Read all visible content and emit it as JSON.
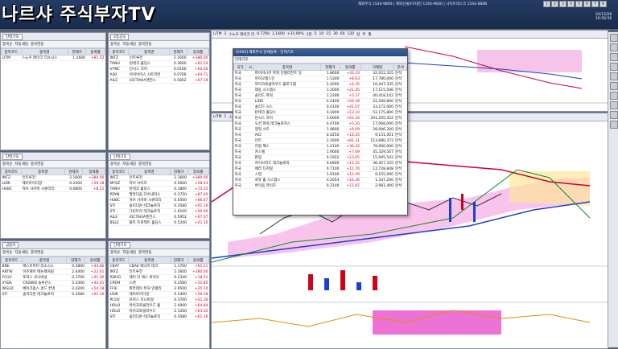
{
  "top": {
    "logo": "나르샤 주식부자TV",
    "hotlines": "해외주식 1544-9800 | 해외선물/FX대전 1544-9600 | 나이트데스크 1544-8888",
    "num_tabs": [
      "1",
      "2",
      "3",
      "4",
      "5",
      "6",
      "7",
      "8"
    ],
    "date": "24/12/28",
    "time": "16:56:56"
  },
  "panels": {
    "p1": {
      "search": "단테기호",
      "chk": [
        "종목순",
        "자동세팅",
        "종목연동"
      ],
      "headers": [
        "종목코드",
        "종목명",
        "현재가",
        "등락률"
      ],
      "rows": [
        [
          "LITM",
          "스노우 레이크 리소시스",
          "1.1600",
          "+81.52"
        ]
      ]
    },
    "p2": {
      "search": "2등공모",
      "chk": [
        "종목순",
        "자동세팅",
        "종목연동"
      ],
      "headers": [
        "종목코드",
        "종목명",
        "현재가",
        "등락률"
      ],
      "rows": [
        [
          "INTZ",
          "인트루전",
          "2.1600",
          "+380.00"
        ],
        [
          "TANH",
          "탄테크 홀딩스",
          "0.3600",
          "+81.54"
        ],
        [
          "VYNC",
          "빈시스 코어",
          "0.0160",
          "+60.00"
        ],
        [
          "AIXI",
          "아이아이스 시트라빈",
          "0.0700",
          "+64.71"
        ],
        [
          "AILE",
          "iOCTAVIA엔전스",
          "0.5852",
          "+67.19"
        ]
      ]
    },
    "p3": {
      "search": "단테기호",
      "chk": [
        "종목순",
        "자동세팅",
        "종목연동"
      ],
      "headers": [
        "종목코드",
        "종목명",
        "현재가",
        "등락률"
      ],
      "rows": [
        [
          "INTZ",
          "인트루전",
          "2.1600",
          "+380.00"
        ],
        [
          "LIDR",
          "에이아이디알",
          "0.2400",
          "+59.38"
        ],
        [
          "HUBC",
          "허브 사이버 시큐리티",
          "0.0800",
          "+8.21"
        ]
      ]
    },
    "p4": {
      "search": "단테기호",
      "chk": [
        "종목순",
        "자동세팅",
        "종목연동"
      ],
      "headers": [
        "종목코드",
        "종목명",
        "현재가",
        "등락률"
      ],
      "rows": [
        [
          "INTZ",
          "인트루전",
          "2.1600",
          "+380.00"
        ],
        [
          "MYSZ",
          "마이 사이즈",
          "0.5000",
          "+58.43"
        ],
        [
          "TANH",
          "탄테크 홀딩스",
          "0.1800",
          "+13.35"
        ],
        [
          "PDYN",
          "팔라디움 다이내믹스",
          "0.3750",
          "+87.40"
        ],
        [
          "HUBC",
          "허브 사이버 시큐리티",
          "0.0500",
          "+66.67"
        ],
        [
          "STI",
          "솔리디온 테크놀로지",
          "0.3580",
          "+61.16"
        ],
        [
          "STI",
          "그린트리 테크놀로지",
          "1.0100",
          "+50.90"
        ],
        [
          "AILE",
          "iOCTAVIA엔전스",
          "0.5952",
          "+67.07"
        ],
        [
          "BSLE",
          "볼트 프로젝트 홀딩스",
          "0.5200",
          "+41.10"
        ]
      ]
    },
    "p5": {
      "search": "금등이",
      "chk": [
        "종목순",
        "자동세팅",
        "종목연동"
      ],
      "headers": [
        "종목코드",
        "종목명",
        "현재가",
        "등락률"
      ],
      "rows": [
        [
          "BNE",
          "에스토퍼미 리소시스",
          "0.3800",
          "+44.80"
        ],
        [
          "ARTW",
          "아츠웨이 매뉴팩처링",
          "2.4400",
          "+22.61"
        ],
        [
          "FCUV",
          "포커스 유니버설",
          "0.3700",
          "+41.36"
        ],
        [
          "VYDA",
          "CROWD 솔루션스",
          "5.3300",
          "+44.91"
        ],
        [
          "WGLD",
          "베이크옵스 골드 컨넥",
          "2.4200",
          "+54.28"
        ],
        [
          "STI",
          "솔리디온 테크놀로지",
          "0.3580",
          "+61.16"
        ]
      ]
    },
    "p6": {
      "search": "단테기호",
      "chk": [
        "종목순",
        "자동세팅",
        "종목연동"
      ],
      "headers": [
        "종목코드",
        "종목명",
        "현재가",
        "등락률"
      ],
      "rows": [
        [
          "CBAT",
          "CBAK 에너지 테크",
          "1.1700",
          "+61.21"
        ],
        [
          "INTZ",
          "인트루전",
          "2.1600",
          "+380.00"
        ],
        [
          "RDHO",
          "레이 디 에스 바이오",
          "0.2340",
          "+18.51"
        ],
        [
          "CPEM",
          "스텐",
          "0.2560",
          "+22.85"
        ],
        [
          "FFIE",
          "파라데이 퓨처 인텔리",
          "2.9500",
          "+25.10"
        ],
        [
          "LIDR",
          "에이아이디알",
          "0.2400",
          "+59.38"
        ],
        [
          "PCUV",
          "포커스 유니버설",
          "0.3700",
          "+41.36"
        ],
        [
          "HOLO",
          "마이크로클라우드 홀",
          "2.4000",
          "+64.84"
        ],
        [
          "HOLO",
          "마이크로클라우드",
          "2.1200",
          "+63.02"
        ],
        [
          "STI",
          "솔리디온 테크놀로지",
          "0.3580",
          "+61.16"
        ]
      ]
    }
  },
  "popup": {
    "title": "[0505] 해외주식 현재등록 - 단테기호",
    "search_label": "단테기호",
    "headers": [
      "국가",
      "시",
      "종목명",
      "현재가",
      "등락률",
      "거래량",
      "분석"
    ],
    "rows": [
      [
        "미국",
        "",
        "파이어니어 파워 인텔리전트 일",
        "1.8600",
        "+33.33",
        "32,022,325",
        "분석"
      ],
      [
        "미국",
        "",
        "아이오랩스인",
        "1.5300",
        "+8.63",
        "17,780,000",
        "분석"
      ],
      [
        "미국",
        "",
        "마이크로클라우드 홀로그램",
        "2.4000",
        "+4.35",
        "16,447,335",
        "분석"
      ],
      [
        "미국",
        "",
        "레옹 시스템스",
        "1.3000",
        "+21.45",
        "17,115,506",
        "분석"
      ],
      [
        "미국",
        "",
        "솔리드 파워",
        "1.2300",
        "+5.37",
        "40,418,102",
        "분석"
      ],
      [
        "미국",
        "",
        "LIDR",
        "0.2400",
        "+59.38",
        "22,209,800",
        "분석"
      ],
      [
        "미국",
        "",
        "솔리드 시스",
        "0.4100",
        "+41.07",
        "33,172,000",
        "분석"
      ],
      [
        "미국",
        "",
        "탄테크 홀딩스",
        "0.1900",
        "+13.10",
        "52,175,800",
        "분석"
      ],
      [
        "미국",
        "",
        "빈시스 코어",
        "3.6000",
        "+61.44",
        "201,205,322",
        "분석"
      ],
      [
        "미국",
        "",
        "오션 파워 테크놀로지스",
        "0.4700",
        "+5.20",
        "17,068,000",
        "분석"
      ],
      [
        "미국",
        "",
        "정밀 시트",
        "1.9800",
        "+9.09",
        "28,946,300",
        "분석"
      ],
      [
        "미국",
        "",
        "AIO",
        "0.4250",
        "+14.25",
        "9,131,001",
        "분석"
      ],
      [
        "미국",
        "",
        "인트",
        "2.1600",
        "+81.31",
        "113,680,372",
        "분석"
      ],
      [
        "미국",
        "",
        "리얼 팩스",
        "1.2100",
        "+36.42",
        "78,900,000",
        "분석"
      ],
      [
        "미국",
        "",
        "카스텔",
        "1.9000",
        "+7.09",
        "45,329,507",
        "분석"
      ],
      [
        "미국",
        "",
        "판업",
        "0.1922",
        "+13.05",
        "15,945,542",
        "분석"
      ],
      [
        "미국",
        "",
        "하이브리드 테크놀로지",
        "0.0900",
        "+12.35",
        "36,457,325",
        "분석"
      ],
      [
        "미국",
        "",
        "베라 디지털",
        "0.7100",
        "+11.76",
        "12,728,848",
        "분석"
      ],
      [
        "미국",
        "",
        "스텐",
        "1.6100",
        "+12.49",
        "9,155,000",
        "분석"
      ],
      [
        "미국",
        "",
        "로봇 홀 시스템스",
        "0.2054",
        "+16.36",
        "1,347,200",
        "분석"
      ],
      [
        "미국",
        "",
        "바이옴 라이즈",
        "0.2100",
        "+11.87",
        "2,981,400",
        "분석"
      ]
    ]
  },
  "chart": {
    "toolbar_top": [
      "LITM",
      "1",
      "스노우 레이크 리",
      "0.7700",
      "1,1600",
      "+35.00%",
      "1분",
      "5",
      "10",
      "15",
      "30",
      "60",
      "120",
      "일",
      "주",
      "월"
    ],
    "toolbar_main": [
      "LITM",
      "1",
      "스노우 레이크",
      "4",
      "1",
      "2",
      "3",
      "5",
      "10",
      "15",
      "30",
      "60",
      "120",
      "일",
      "주",
      "월"
    ],
    "price_labels_main": [
      "1.1600",
      "1.0000",
      "0.9000",
      "0.8000",
      "0.7000"
    ],
    "indicator_labels": [
      "10,000,000",
      "5,000,000",
      "0"
    ]
  }
}
